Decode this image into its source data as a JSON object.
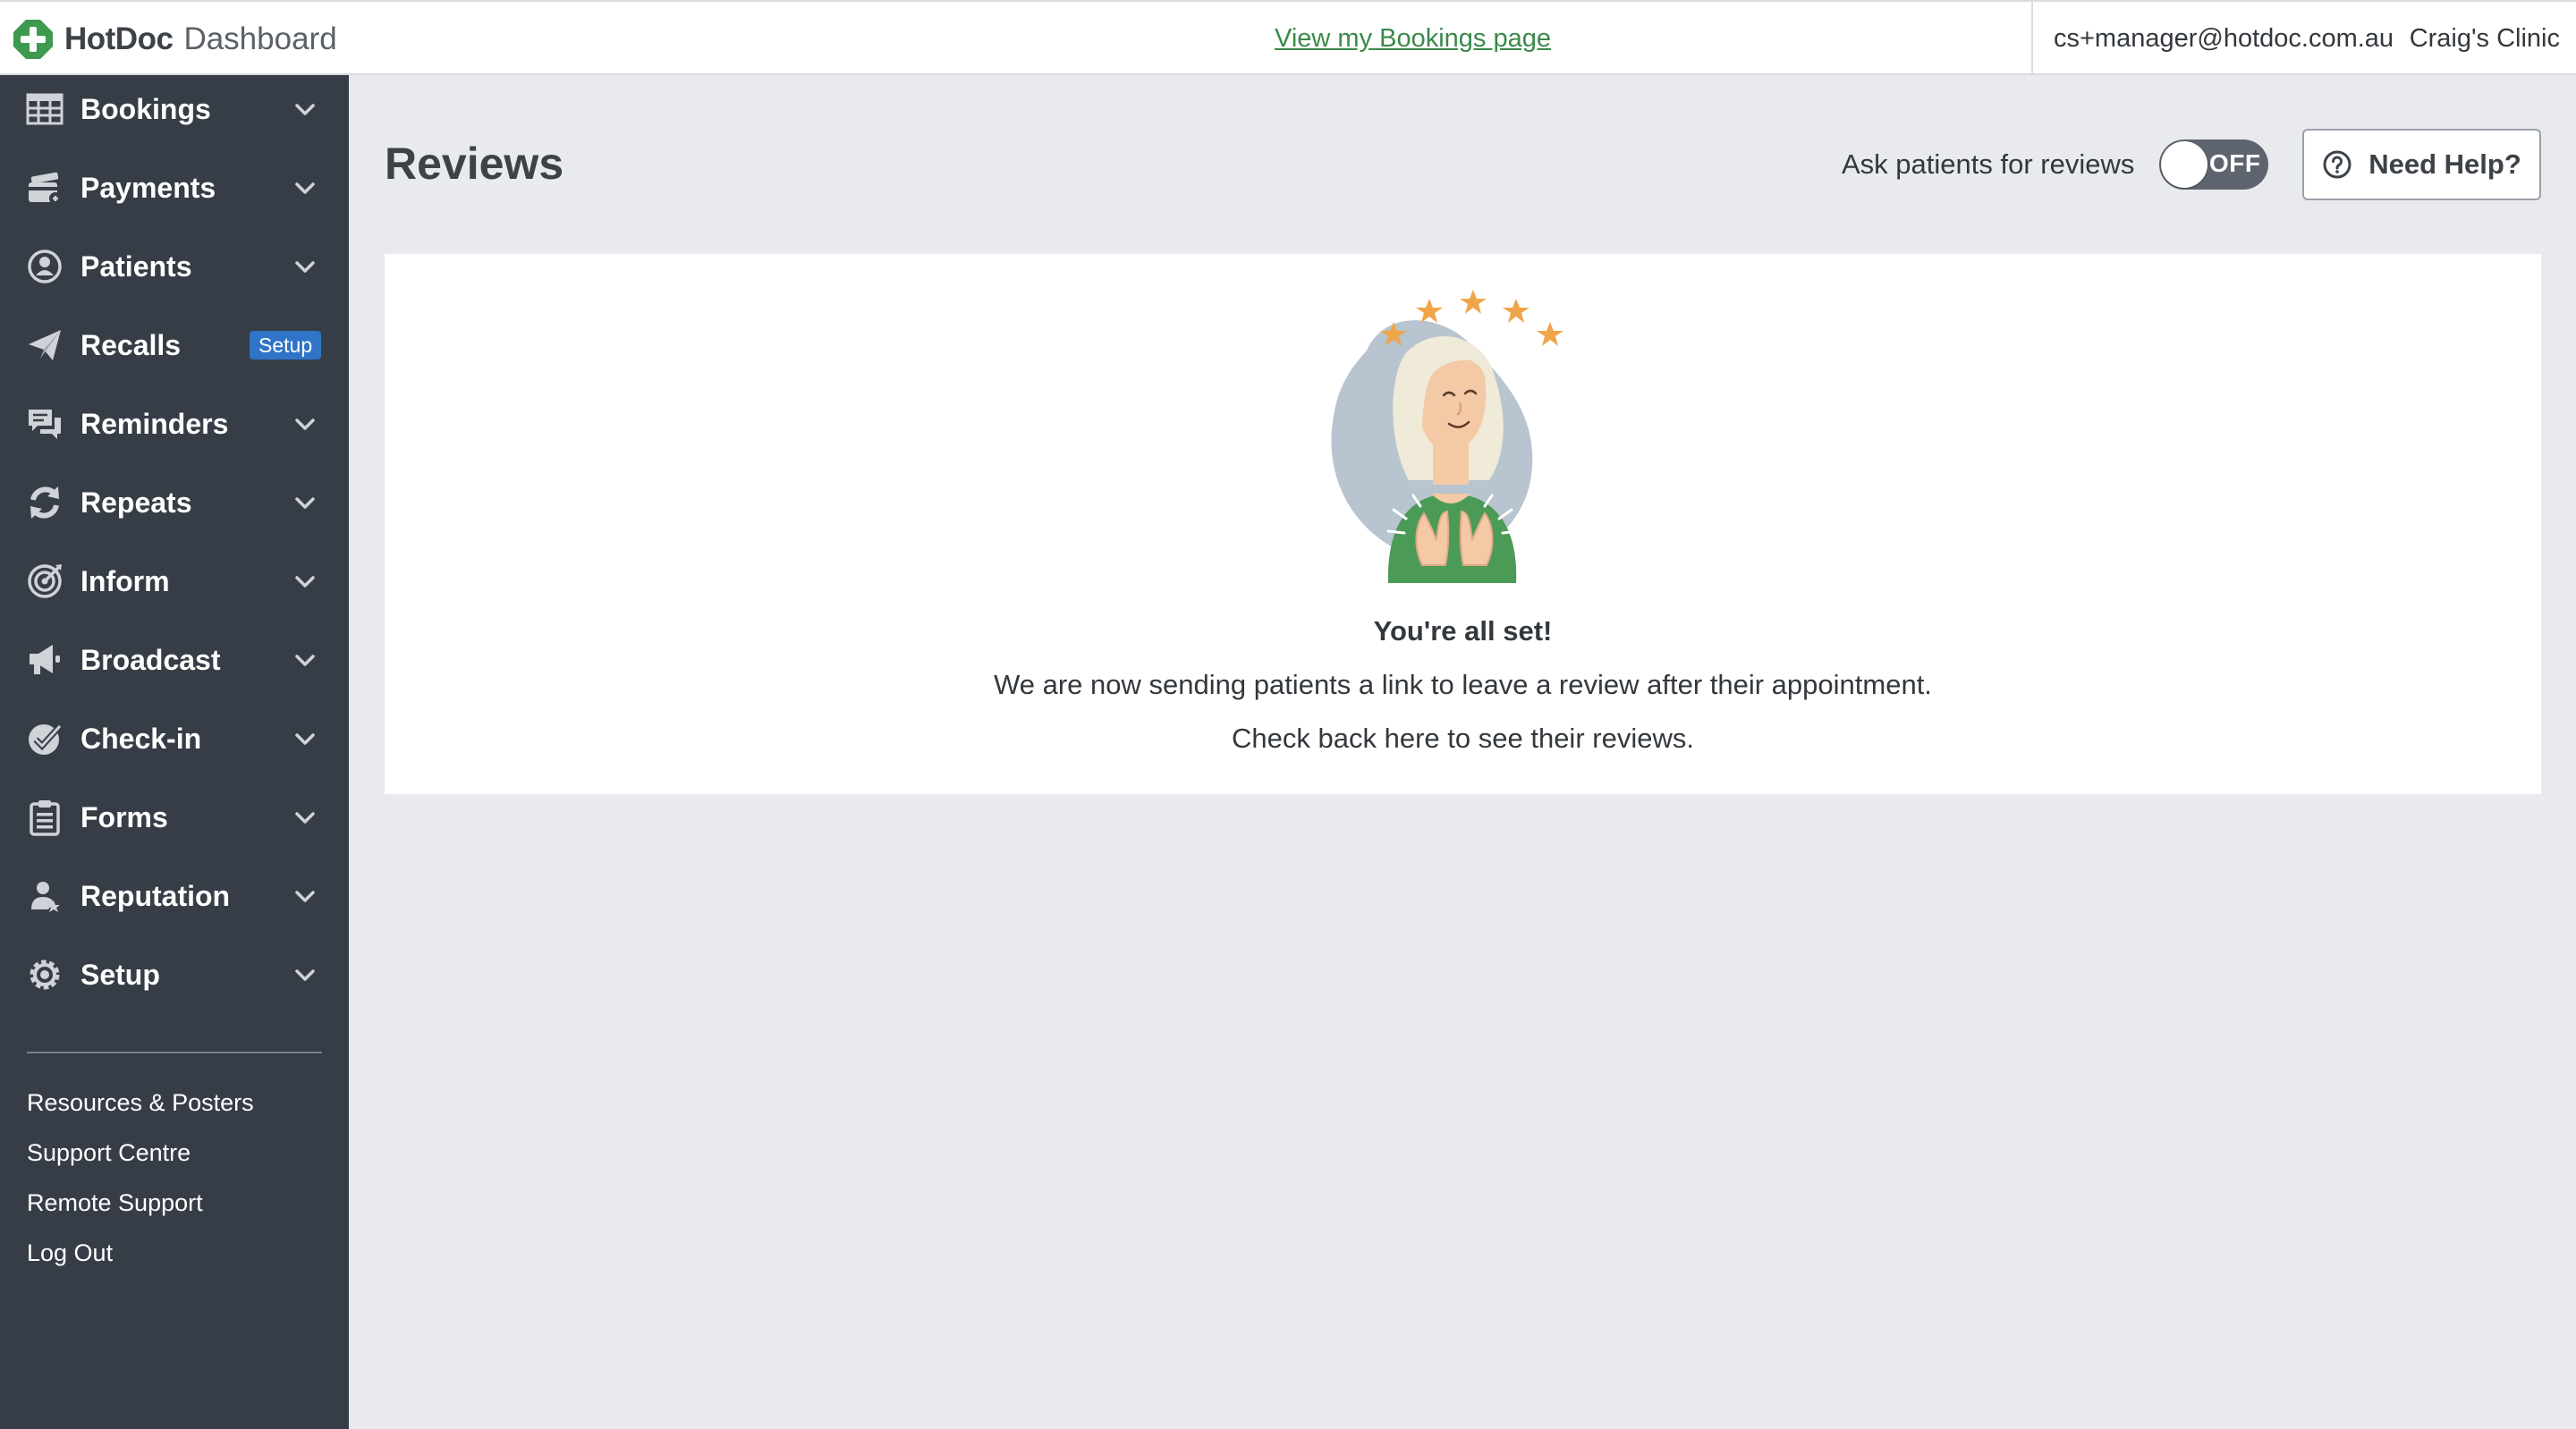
{
  "header": {
    "brand": "HotDoc",
    "product": "Dashboard",
    "bookings_link": "View my Bookings page",
    "user_email": "cs+manager@hotdoc.com.au",
    "clinic": "Craig's Clinic"
  },
  "sidebar": {
    "items": [
      {
        "label": "Bookings",
        "icon": "table-icon",
        "chevron": true
      },
      {
        "label": "Payments",
        "icon": "card-icon",
        "chevron": true
      },
      {
        "label": "Patients",
        "icon": "person-circle-icon",
        "chevron": true
      },
      {
        "label": "Recalls",
        "icon": "paper-plane-icon",
        "badge": "Setup"
      },
      {
        "label": "Reminders",
        "icon": "chat-bubbles-icon",
        "chevron": true
      },
      {
        "label": "Repeats",
        "icon": "refresh-icon",
        "chevron": true
      },
      {
        "label": "Inform",
        "icon": "target-icon",
        "chevron": true
      },
      {
        "label": "Broadcast",
        "icon": "megaphone-icon",
        "chevron": true
      },
      {
        "label": "Check-in",
        "icon": "check-badge-icon",
        "chevron": true
      },
      {
        "label": "Forms",
        "icon": "clipboard-icon",
        "chevron": true
      },
      {
        "label": "Reputation",
        "icon": "person-star-icon",
        "chevron": true
      },
      {
        "label": "Setup",
        "icon": "gear-icon",
        "chevron": true
      }
    ],
    "links": [
      "Resources & Posters",
      "Support Centre",
      "Remote Support",
      "Log Out"
    ]
  },
  "main": {
    "title": "Reviews",
    "toggle_label": "Ask patients for reviews",
    "toggle_state": "OFF",
    "help_label": "Need Help?",
    "empty_state": {
      "title": "You're all set!",
      "line1": "We are now sending patients a link to leave a review after their appointment.",
      "line2": "Check back here to see their reviews."
    }
  },
  "colors": {
    "sidebar_bg": "#373d47",
    "link_green": "#3a8a4a",
    "badge_blue": "#2f74c7",
    "page_bg": "#e8eaed",
    "star_orange": "#efa64b"
  }
}
